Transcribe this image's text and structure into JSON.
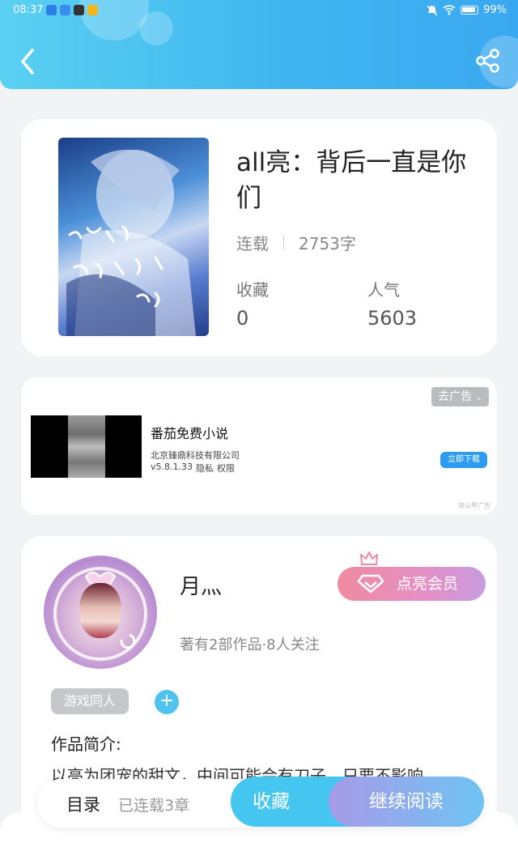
{
  "colors": {
    "header_gradient_start": "#5ad0f2",
    "header_gradient_end": "#3aa8f0",
    "accent": "#45c6f0",
    "vip_pink": "#f08aa0"
  },
  "status_bar": {
    "time": "08:37",
    "battery": "99%"
  },
  "header": {
    "back_icon": "chevron-left-icon",
    "share_icon": "share-icon"
  },
  "book": {
    "title": "all亮：背后一直是你们",
    "status": "连载",
    "word_count": "2753字",
    "collect_label": "收藏",
    "collect_value": "0",
    "popularity_label": "人气",
    "popularity_value": "5603"
  },
  "ad": {
    "remove_label": "去广告",
    "title": "番茄免费小说",
    "company": "北京臻鼎科技有限公司",
    "version": "v5.8.1.33",
    "privacy": "隐私",
    "permissions": "权限",
    "download_label": "立即下载",
    "source": "穿山甲广告"
  },
  "author": {
    "name": "月灬",
    "vip_label": "点亮会员",
    "meta": "著有2部作品·8人关注",
    "tag": "游戏同人",
    "add_tag": "+",
    "intro_label": "作品简介:",
    "intro_text": "以亮为团宠的甜文，中间可能会有刀子，只要不影响"
  },
  "bottom_bar": {
    "toc_label": "目录",
    "chapters": "已连载3章",
    "collect_button": "收藏",
    "read_button": "继续阅读"
  }
}
